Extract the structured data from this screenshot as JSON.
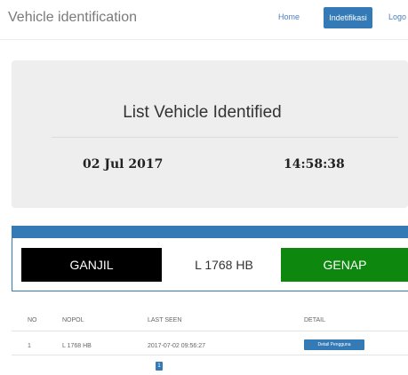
{
  "navbar": {
    "brand": "Vehicle identification",
    "links": [
      "Home",
      "Indetifikasi",
      "Logo"
    ]
  },
  "jumbotron": {
    "title": "List Vehicle Identified",
    "date": "02 Jul 2017",
    "time": "14:58:38"
  },
  "plate_panel": {
    "odd_label": "GANJIL",
    "plate": "L 1768 HB",
    "even_label": "GENAP"
  },
  "table": {
    "headers": [
      "NO",
      "NOPOL",
      "LAST SEEN",
      "DETAIL"
    ],
    "rows": [
      {
        "no": "1",
        "nopol": "L 1768 HB",
        "last_seen": "2017-07-02 09:56:27",
        "detail_label": "Detail Pengguna"
      }
    ]
  },
  "pagination": {
    "current": "1"
  },
  "colors": {
    "primary": "#337ab7",
    "genap": "#0d870d",
    "ganjil": "#000000"
  }
}
